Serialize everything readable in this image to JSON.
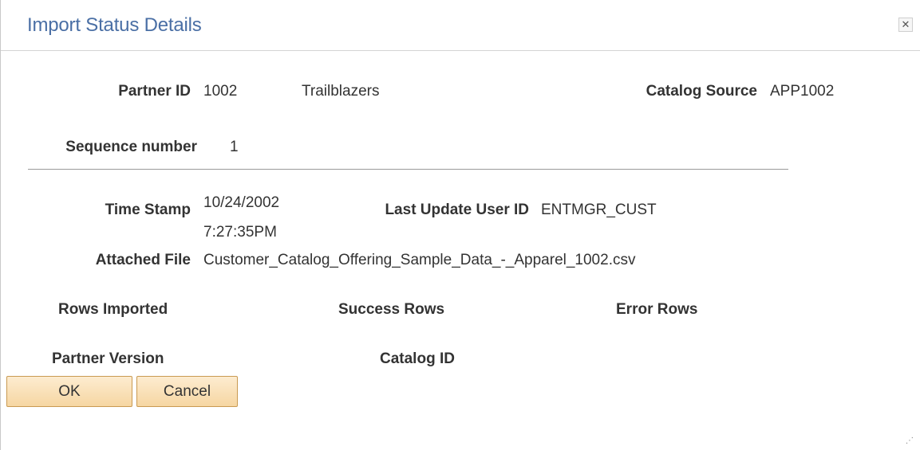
{
  "dialog": {
    "title": "Import Status Details",
    "close_icon": "close-icon"
  },
  "fields": {
    "partner_id_label": "Partner ID",
    "partner_id_value": "1002",
    "partner_name": "Trailblazers",
    "catalog_source_label": "Catalog Source",
    "catalog_source_value": "APP1002",
    "sequence_label": "Sequence number",
    "sequence_value": "1",
    "time_stamp_label": "Time Stamp",
    "time_stamp_date": "10/24/2002",
    "time_stamp_time": "7:27:35PM",
    "last_update_label": "Last Update User ID",
    "last_update_value": "ENTMGR_CUST",
    "attached_file_label": "Attached File",
    "attached_file_value": "Customer_Catalog_Offering_Sample_Data_-_Apparel_1002.csv",
    "rows_imported_label": "Rows Imported",
    "success_rows_label": "Success Rows",
    "error_rows_label": "Error Rows",
    "partner_version_label": "Partner Version",
    "catalog_id_label": "Catalog ID"
  },
  "buttons": {
    "ok_label": "OK",
    "cancel_label": "Cancel"
  }
}
